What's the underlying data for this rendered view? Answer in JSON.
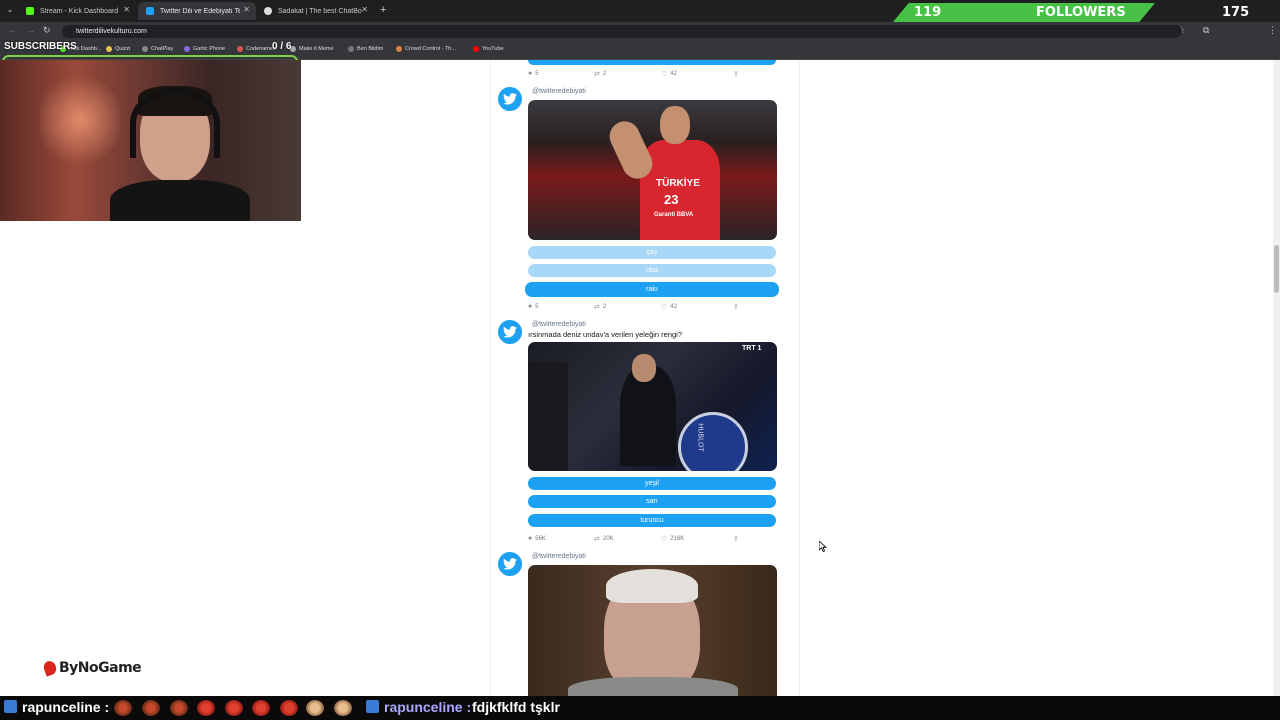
{
  "tabs": [
    {
      "title": "Stream - Kick Dashboard",
      "active": false
    },
    {
      "title": "Twitter Dili ve Edebiyatı Testini",
      "active": true
    },
    {
      "title": "Sadakat | The best ChatBot and",
      "active": false
    }
  ],
  "address": {
    "url": "twitterdilivekulturu.com"
  },
  "bookmarks": [
    "Kick Dashb...",
    "Quizzi",
    "ChatPlay",
    "Gartic Phone",
    "Codenames",
    "Make it Meme",
    "Ben Bildim",
    "Crowd Control - Th...",
    "YouTube"
  ],
  "overlay": {
    "followers_count": "119",
    "followers_label": "FOLLOWERS",
    "followers_goal": "175",
    "subscribers_label": "SUBSCRIBERS",
    "subscribers_progress": "0 / 6",
    "brand": "ByNoGame"
  },
  "feed": {
    "top_actions": {
      "comments": "5",
      "retweets": "2",
      "likes": "42"
    },
    "tweets": [
      {
        "handle": "@twitteredebiyati",
        "question": "",
        "options": [
          "çay",
          "nba",
          "rakı"
        ],
        "actions": {
          "comments": "5",
          "retweets": "2",
          "likes": "42"
        }
      },
      {
        "handle": "@twitteredebiyati",
        "question": "ırsinmada deniz undav'a verilen yeleğin rengi?",
        "options": [
          "yeşil",
          "sarı",
          "turuncu"
        ],
        "actions": {
          "comments": "56K",
          "retweets": "20K",
          "likes": "216K"
        }
      },
      {
        "handle": "@twitteredebiyati",
        "question": "",
        "options": [],
        "actions": {}
      }
    ],
    "media_text": {
      "jersey_team": "TÜRKİYE",
      "jersey_number": "23",
      "jersey_sponsor": "Garanti BBVA",
      "tv_logo": "TRT 1",
      "ad_board": "HUBLOT"
    }
  },
  "chat": {
    "user1": "rapunceline :",
    "user2": "rapunceline :",
    "message2": "fdjkfklfd tşklr"
  },
  "colors": {
    "twitter_blue": "#1da1f2",
    "twitter_blue_dim": "#a8d8f8",
    "followers_green": "#47c247"
  }
}
